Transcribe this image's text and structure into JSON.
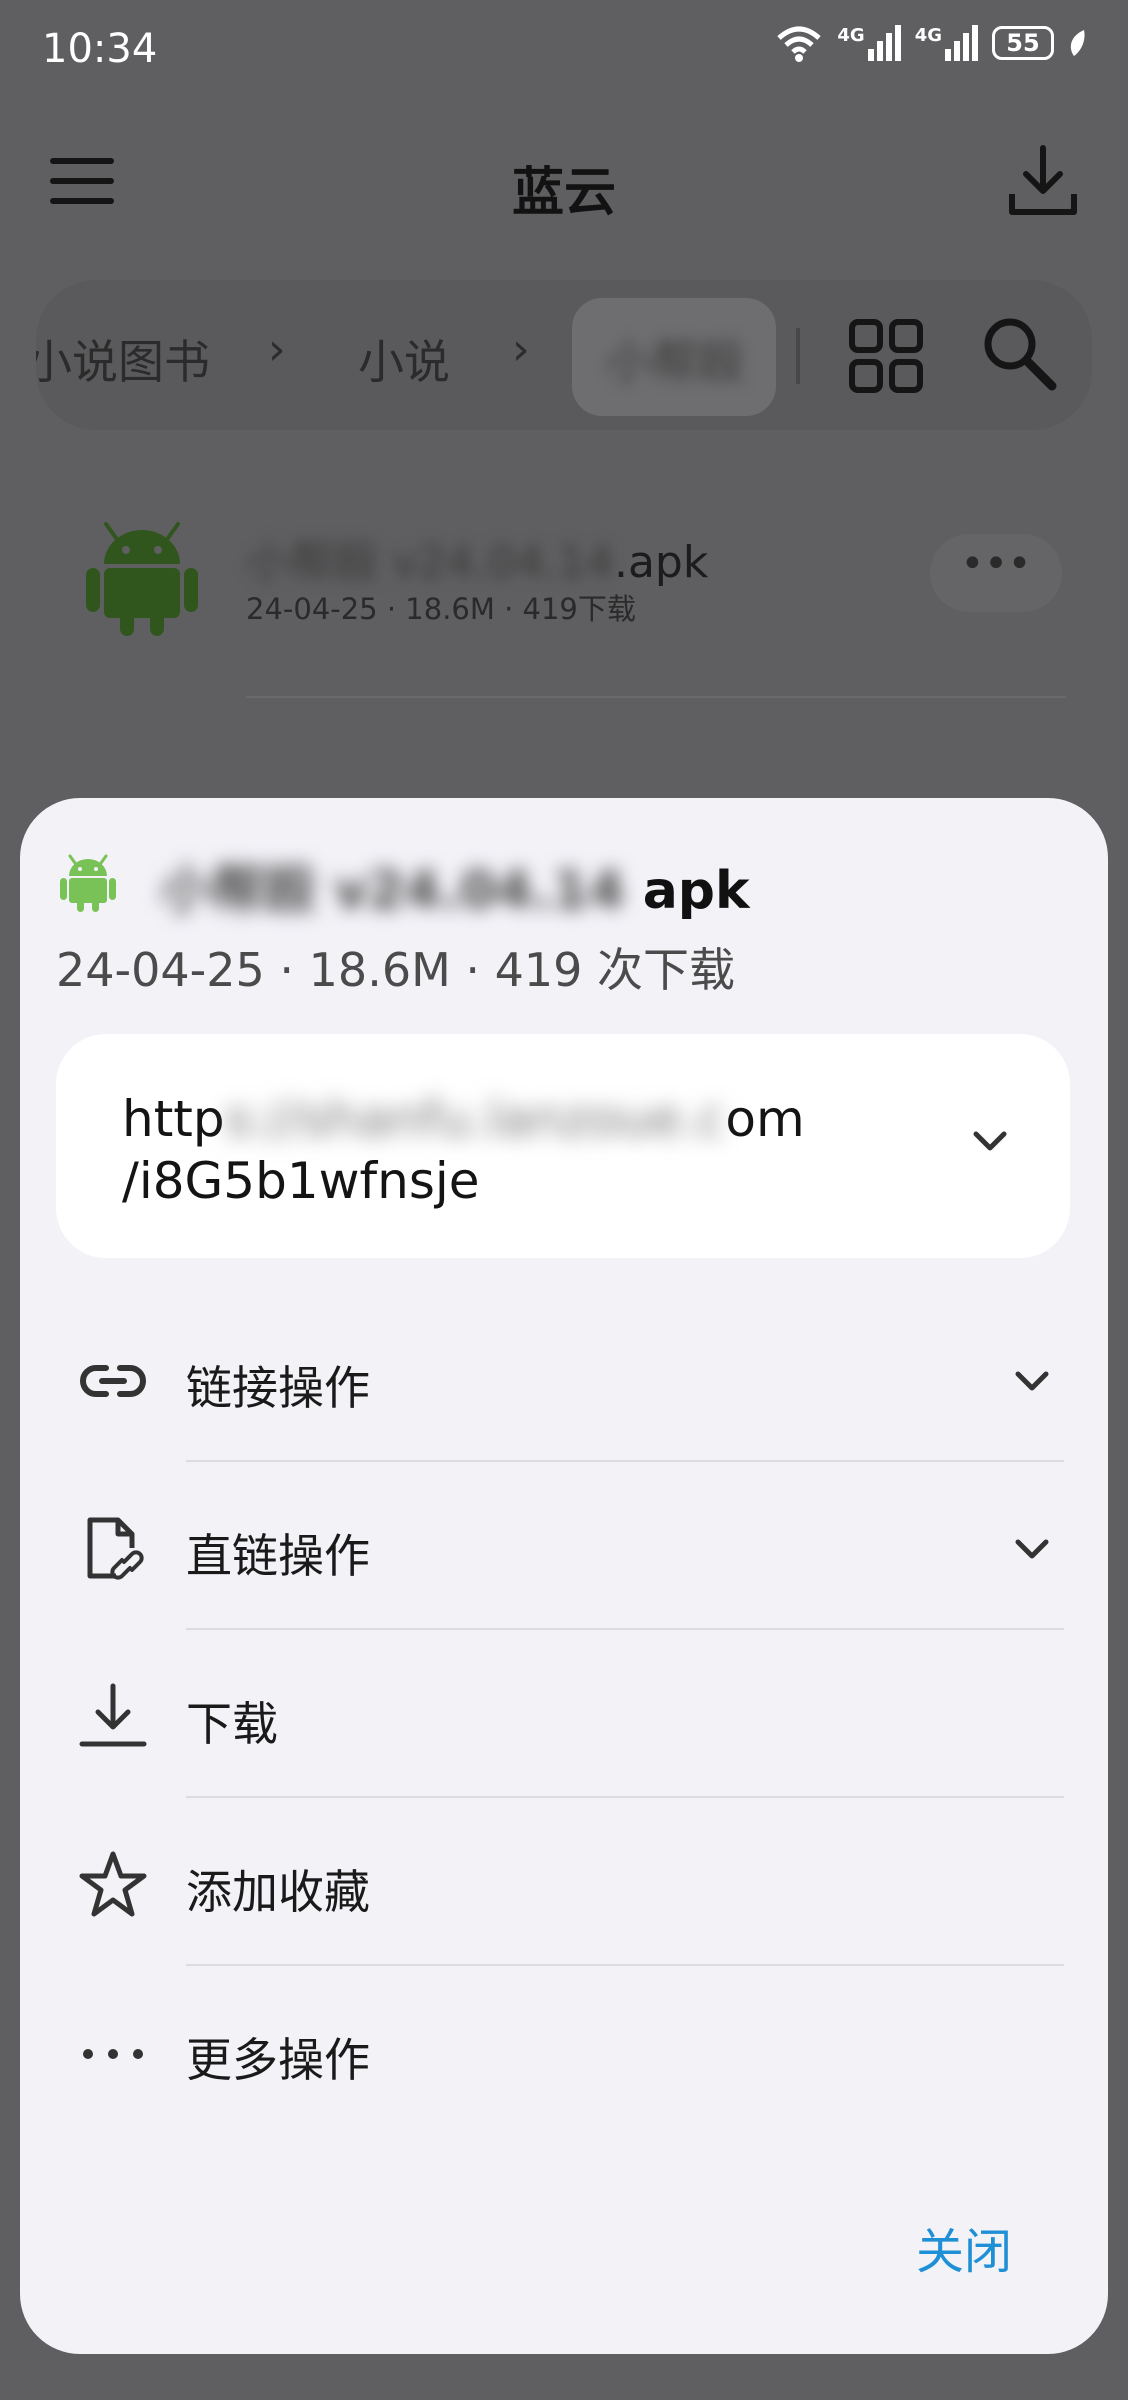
{
  "status_bar": {
    "time": "10:34",
    "network_1": "4G",
    "network_2": "4G",
    "battery": "55"
  },
  "app_bar": {
    "title": "蓝云",
    "menu_icon": "menu-icon",
    "download_icon": "download-icon"
  },
  "breadcrumb": {
    "items": [
      "小说图书",
      "小说"
    ],
    "current": "小帮殴",
    "view_icon": "grid-icon",
    "search_icon": "search-icon"
  },
  "file_list": {
    "items": [
      {
        "name_blurred": "小帮殴 v24.04.14",
        "name_ext": ".apk",
        "meta": "24-04-25 · 18.6M · 419下载"
      }
    ]
  },
  "sheet": {
    "title_blurred": "小帮殴 v24.04.14",
    "title_ext": "apk",
    "meta": "24-04-25 · 18.6M · 419 次下载",
    "url_prefix": "http",
    "url_blurred": "s://shanfu.lanzoue.c",
    "url_suffix": "om",
    "url_line2": "/i8G5b1wfnsje",
    "actions": [
      {
        "label": "链接操作",
        "icon": "link-icon",
        "expandable": true
      },
      {
        "label": "直链操作",
        "icon": "file-link-icon",
        "expandable": true
      },
      {
        "label": "下载",
        "icon": "download-icon",
        "expandable": false
      },
      {
        "label": "添加收藏",
        "icon": "star-icon",
        "expandable": false
      },
      {
        "label": "更多操作",
        "icon": "more-icon",
        "expandable": false
      }
    ],
    "close_label": "关闭"
  },
  "colors": {
    "accent": "#1f8fd6",
    "android_green": "#78c257",
    "scrim": "#5f5f61",
    "sheet_bg": "#f3f2f7"
  }
}
